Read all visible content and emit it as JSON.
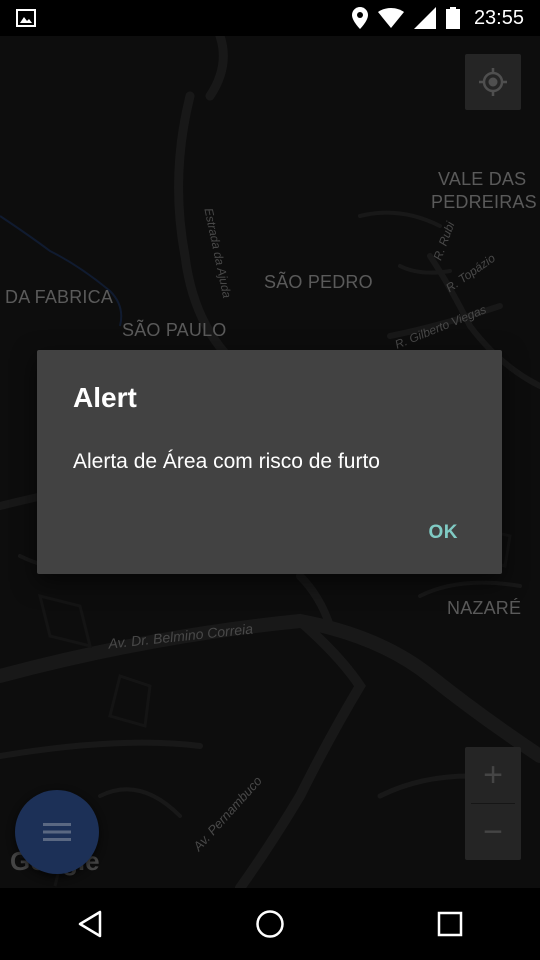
{
  "status_bar": {
    "time": "23:55",
    "icons": [
      "gallery-icon",
      "location-icon",
      "wifi-icon",
      "signal-icon",
      "battery-icon"
    ]
  },
  "map": {
    "labels": {
      "vale_das_pedreiras_1": "VALE DAS",
      "vale_das_pedreiras_2": "PEDREIRAS",
      "da_fabrica": "DA FABRICA",
      "sao_pedro": "SÃO PEDRO",
      "sao_paulo": "SÃO PAULO",
      "nazare": "NAZARÉ"
    },
    "streets": {
      "estrada": "Estrada da Ajuda",
      "r_rubi": "R. Rubi",
      "r_topazio": "R. Topázio",
      "r_gilberto": "R. Gilberto Viegas",
      "belmino": "Av. Dr. Belmino Correia",
      "pernambuco": "Av. Pernambuco"
    },
    "google": "Google",
    "zoom_in": "+",
    "zoom_out": "−"
  },
  "dialog": {
    "title": "Alert",
    "message": "Alerta de Área com risco de furto",
    "ok_label": "OK"
  },
  "colors": {
    "dialog_bg": "#424242",
    "accent": "#80cbc4",
    "fab": "#2b4a86"
  }
}
